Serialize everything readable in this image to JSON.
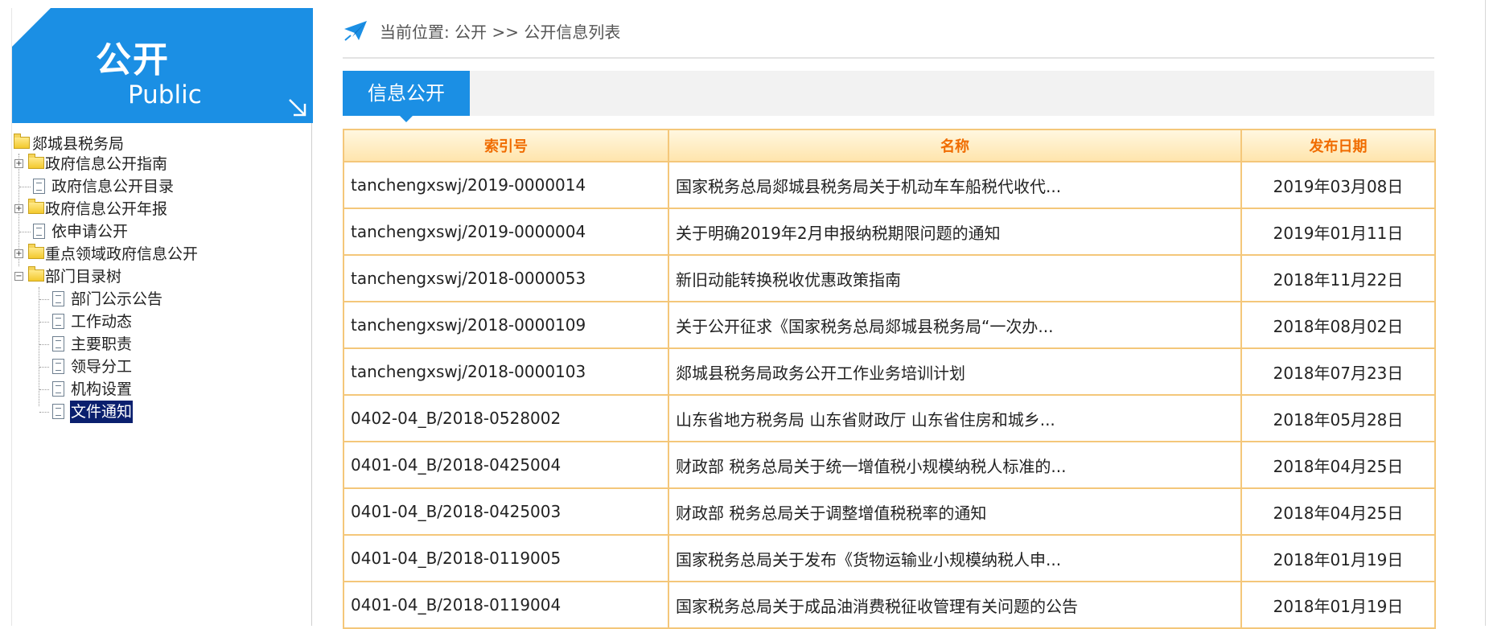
{
  "sidebar": {
    "title_cn": "公开",
    "title_en": "Public",
    "root": "郯城县税务局",
    "items": [
      {
        "label": "政府信息公开指南",
        "type": "folder",
        "expander": "+"
      },
      {
        "label": "政府信息公开目录",
        "type": "doc"
      },
      {
        "label": "政府信息公开年报",
        "type": "folder",
        "expander": "+"
      },
      {
        "label": "依申请公开",
        "type": "doc"
      },
      {
        "label": "重点领域政府信息公开",
        "type": "folder",
        "expander": "+"
      },
      {
        "label": "部门目录树",
        "type": "folder",
        "expander": "−"
      }
    ],
    "children": [
      {
        "label": "部门公示公告"
      },
      {
        "label": "工作动态"
      },
      {
        "label": "主要职责"
      },
      {
        "label": "领导分工"
      },
      {
        "label": "机构设置"
      },
      {
        "label": "文件通知",
        "selected": true
      }
    ]
  },
  "breadcrumb": {
    "text": "当前位置: 公开 >> 公开信息列表"
  },
  "tab": {
    "label": "信息公开"
  },
  "table": {
    "headers": [
      "索引号",
      "名称",
      "发布日期"
    ],
    "rows": [
      [
        "tanchengxswj/2019-0000014",
        "国家税务总局郯城县税务局关于机动车车船税代收代...",
        "2019年03月08日"
      ],
      [
        "tanchengxswj/2019-0000004",
        "关于明确2019年2月申报纳税期限问题的通知",
        "2019年01月11日"
      ],
      [
        "tanchengxswj/2018-0000053",
        "新旧动能转换税收优惠政策指南",
        "2018年11月22日"
      ],
      [
        "tanchengxswj/2018-0000109",
        "关于公开征求《国家税务总局郯城县税务局“一次办...",
        "2018年08月02日"
      ],
      [
        "tanchengxswj/2018-0000103",
        "郯城县税务局政务公开工作业务培训计划",
        "2018年07月23日"
      ],
      [
        "0402-04_B/2018-0528002",
        "山东省地方税务局 山东省财政厅 山东省住房和城乡...",
        "2018年05月28日"
      ],
      [
        "0401-04_B/2018-0425004",
        "财政部 税务总局关于统一增值税小规模纳税人标准的...",
        "2018年04月25日"
      ],
      [
        "0401-04_B/2018-0425003",
        "财政部 税务总局关于调整增值税税率的通知",
        "2018年04月25日"
      ],
      [
        "0401-04_B/2018-0119005",
        "国家税务总局关于发布《货物运输业小规模纳税人申...",
        "2018年01月19日"
      ],
      [
        "0401-04_B/2018-0119004",
        "国家税务总局关于成品油消费税征收管理有关问题的公告",
        "2018年01月19日"
      ]
    ]
  },
  "colors": {
    "accent": "#1b8fe4",
    "header_text": "#f06c00",
    "border": "#f4c77a"
  }
}
